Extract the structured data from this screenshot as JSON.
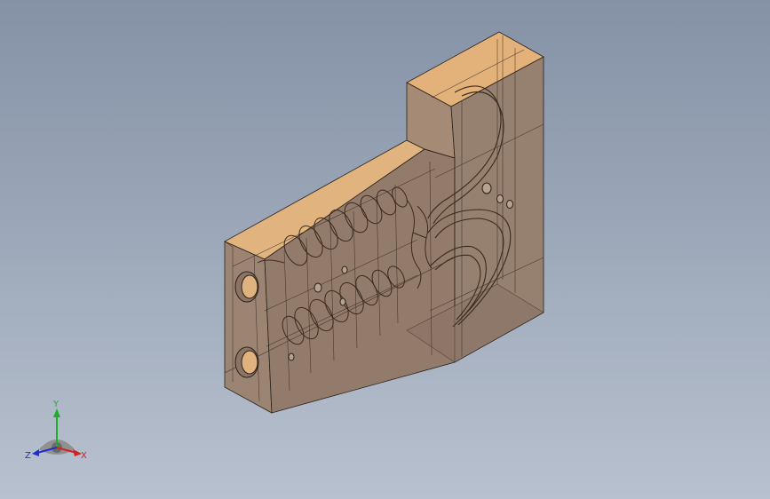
{
  "triad": {
    "x_label": "X",
    "y_label": "Y",
    "z_label": "Z",
    "x_color": "#d42020",
    "y_color": "#1fae2a",
    "z_color": "#1d2fd0"
  },
  "model": {
    "top_face_color": "#e3b27a",
    "side_face_color": "#a08672",
    "front_face_color": "#8f786a",
    "edge_color": "#2a211b"
  }
}
